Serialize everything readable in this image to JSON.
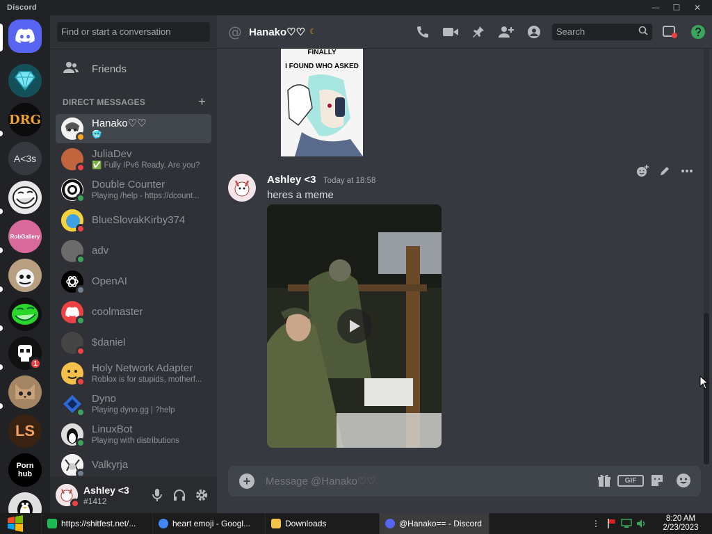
{
  "window": {
    "title": "Discord",
    "minimize": "—",
    "maximize": "☐",
    "close": "✕"
  },
  "servers": [
    {
      "id": "home",
      "label": "",
      "color": "#5865f2"
    },
    {
      "id": "diamond",
      "label": "",
      "color": "#1b6d7a"
    },
    {
      "id": "drg",
      "label": "DRG",
      "color": "#0c0c0c"
    },
    {
      "id": "a3s",
      "label": "A<3s",
      "color": "#36393f"
    },
    {
      "id": "troll",
      "label": "",
      "color": "#e8e8e8"
    },
    {
      "id": "robgallery",
      "label": "RobGallery",
      "color": "#d76a9a"
    },
    {
      "id": "sans",
      "label": "",
      "color": "#d6c1a7"
    },
    {
      "id": "trollgreen",
      "label": "",
      "color": "#111"
    },
    {
      "id": "skull",
      "label": "",
      "color": "#111",
      "badge": "1"
    },
    {
      "id": "cat",
      "label": "",
      "color": "#a58664"
    },
    {
      "id": "ls",
      "label": "LS",
      "color": "#3a2212"
    },
    {
      "id": "ph",
      "label": "Porn hub",
      "color": "#000"
    },
    {
      "id": "penguin",
      "label": "",
      "color": "#e0e0e0"
    }
  ],
  "dm_sidebar": {
    "search_placeholder": "Find or start a conversation",
    "friends_label": "Friends",
    "section_label": "DIRECT MESSAGES",
    "add_label": "+",
    "items": [
      {
        "name": "Hanako♡♡",
        "sub": "",
        "status": "idle",
        "color": "#d9d9d9",
        "active": true
      },
      {
        "name": "JuliaDev",
        "sub": "✅ Fully IPv6 Ready. Are you?",
        "status": "dnd",
        "color": "#c0653e"
      },
      {
        "name": "Double Counter",
        "sub": "Playing /help - https://dcount...",
        "status": "online",
        "color": "#ffffff"
      },
      {
        "name": "BlueSlovakKirby374",
        "sub": "",
        "status": "dnd",
        "color": "#3da1e4"
      },
      {
        "name": "adv",
        "sub": "",
        "status": "online",
        "color": "#6b6b6b"
      },
      {
        "name": "OpenAI",
        "sub": "",
        "status": "offline",
        "color": "#000000"
      },
      {
        "name": "coolmaster",
        "sub": "",
        "status": "online",
        "color": "#ed4245"
      },
      {
        "name": "$daniel",
        "sub": "",
        "status": "dnd",
        "color": "#444"
      },
      {
        "name": "Holy Network Adapter",
        "sub": "Roblox is for stupids, motherf...",
        "status": "dnd",
        "color": "#f5c04a"
      },
      {
        "name": "Dyno",
        "sub": "Playing dyno.gg | ?help",
        "status": "online",
        "color": "#2b6ad6"
      },
      {
        "name": "LinuxBot",
        "sub": "Playing with distributions",
        "status": "online",
        "color": "#ddd"
      },
      {
        "name": "Valkyrja",
        "sub": "",
        "status": "offline",
        "color": "#eee"
      }
    ]
  },
  "user_panel": {
    "name": "Ashley <3",
    "tag": "#1412",
    "status": "dnd"
  },
  "header": {
    "at": "@",
    "name": "Hanako♡♡",
    "search_placeholder": "Search"
  },
  "messages": {
    "meme_caption_1": "FINALLY",
    "meme_caption_2": "I FOUND WHO ASKED",
    "author": "Ashley <3",
    "timestamp": "Today at 18:58",
    "text": "heres a meme"
  },
  "composer": {
    "placeholder": "Message @Hanako♡♡",
    "gif_label": "GIF"
  },
  "taskbar": {
    "items": [
      {
        "label": "https://shitfest.net/...",
        "color": "#1db954"
      },
      {
        "label": "heart emoji - Googl...",
        "color": "#4285f4"
      },
      {
        "label": "Downloads",
        "color": "#f4c34a"
      },
      {
        "label": "@Hanako== - Discord",
        "color": "#5865f2",
        "active": true
      }
    ],
    "time": "8:20 AM",
    "date": "2/23/2023"
  }
}
